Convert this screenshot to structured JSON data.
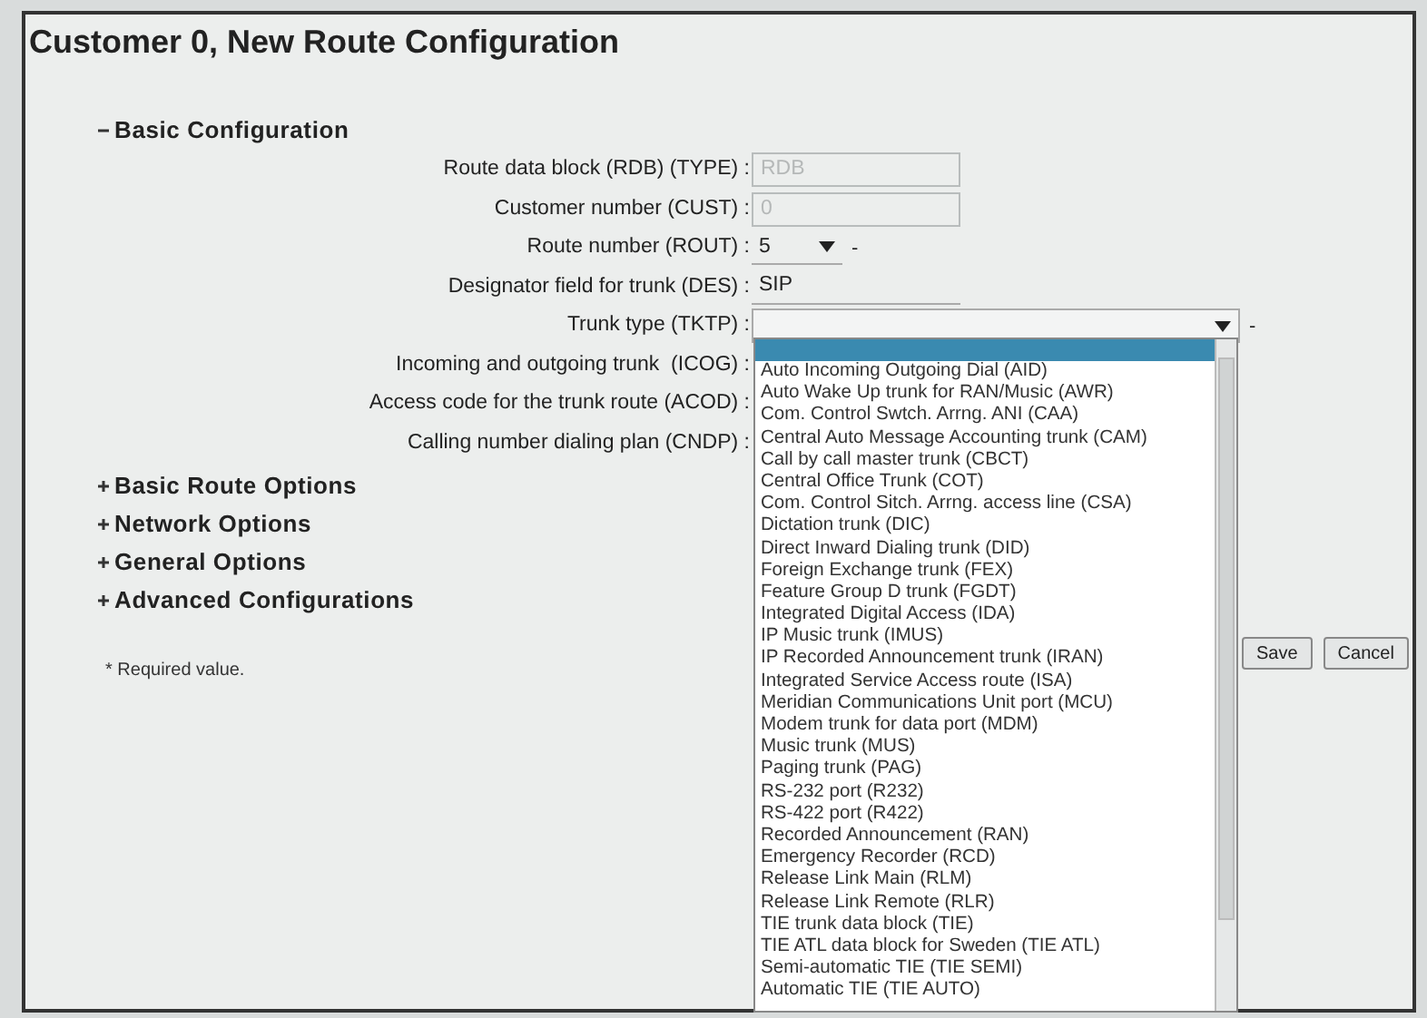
{
  "title": "Customer 0, New Route Configuration",
  "sections": [
    {
      "label": "Basic Configuration",
      "expanded": true,
      "fields": [
        {
          "label": "Route data block (RDB) (TYPE) :",
          "kind": "text",
          "disabled": true,
          "value": "RDB"
        },
        {
          "label": "Customer number (CUST) :",
          "kind": "text",
          "disabled": true,
          "value": "0"
        },
        {
          "label": "Route number (ROUT) :",
          "kind": "select",
          "value": "5",
          "suffix": "-",
          "open": false
        },
        {
          "label": "Designator field for trunk (DES) :",
          "kind": "text",
          "disabled": false,
          "value": "SIP"
        },
        {
          "label": "Trunk type (TKTP) :",
          "kind": "select",
          "suffix": "-",
          "open": true
        },
        {
          "label": "Incoming and outgoing trunk  (ICOG) :"
        },
        {
          "label": "Access code for the trunk route (ACOD) :"
        },
        {
          "label": "Calling number dialing plan (CNDP) :"
        }
      ]
    },
    {
      "label": "Basic Route Options",
      "expanded": false
    },
    {
      "label": "Network Options",
      "expanded": false
    },
    {
      "label": "General Options",
      "expanded": false
    },
    {
      "label": "Advanced Configurations",
      "expanded": false
    }
  ],
  "required_note": "* Required value.",
  "buttons": [
    {
      "label": "Save"
    },
    {
      "label": "Cancel"
    }
  ],
  "trunk_type_dropdown": {
    "blank_option_selected": true,
    "options": [
      "Auto Incoming Outgoing Dial (AID)",
      "Auto Wake Up trunk for RAN/Music (AWR)",
      "Com. Control Swtch. Arrng. ANI (CAA)",
      "Central Auto Message Accounting trunk (CAM)",
      "Call by call master trunk (CBCT)",
      "Central Office Trunk (COT)",
      "Com. Control Sitch. Arrng. access line (CSA)",
      "Dictation trunk (DIC)",
      "Direct Inward Dialing trunk (DID)",
      "Foreign Exchange trunk (FEX)",
      "Feature Group D trunk (FGDT)",
      "Integrated Digital Access (IDA)",
      "IP Music trunk (IMUS)",
      "IP Recorded Announcement trunk (IRAN)",
      "Integrated Service Access route  (ISA)",
      "Meridian Communications Unit port (MCU)",
      "Modem trunk for data port (MDM)",
      "Music trunk (MUS)",
      "Paging trunk (PAG)",
      "RS-232 port (R232)",
      "RS-422 port (R422)",
      "Recorded Announcement (RAN)",
      "Emergency Recorder (RCD)",
      "Release Link Main (RLM)",
      "Release Link Remote (RLR)",
      "TIE trunk data block (TIE)",
      "TIE ATL data block for Sweden (TIE ATL)",
      "Semi-automatic TIE (TIE SEMI)",
      "Automatic TIE (TIE AUTO)"
    ]
  }
}
